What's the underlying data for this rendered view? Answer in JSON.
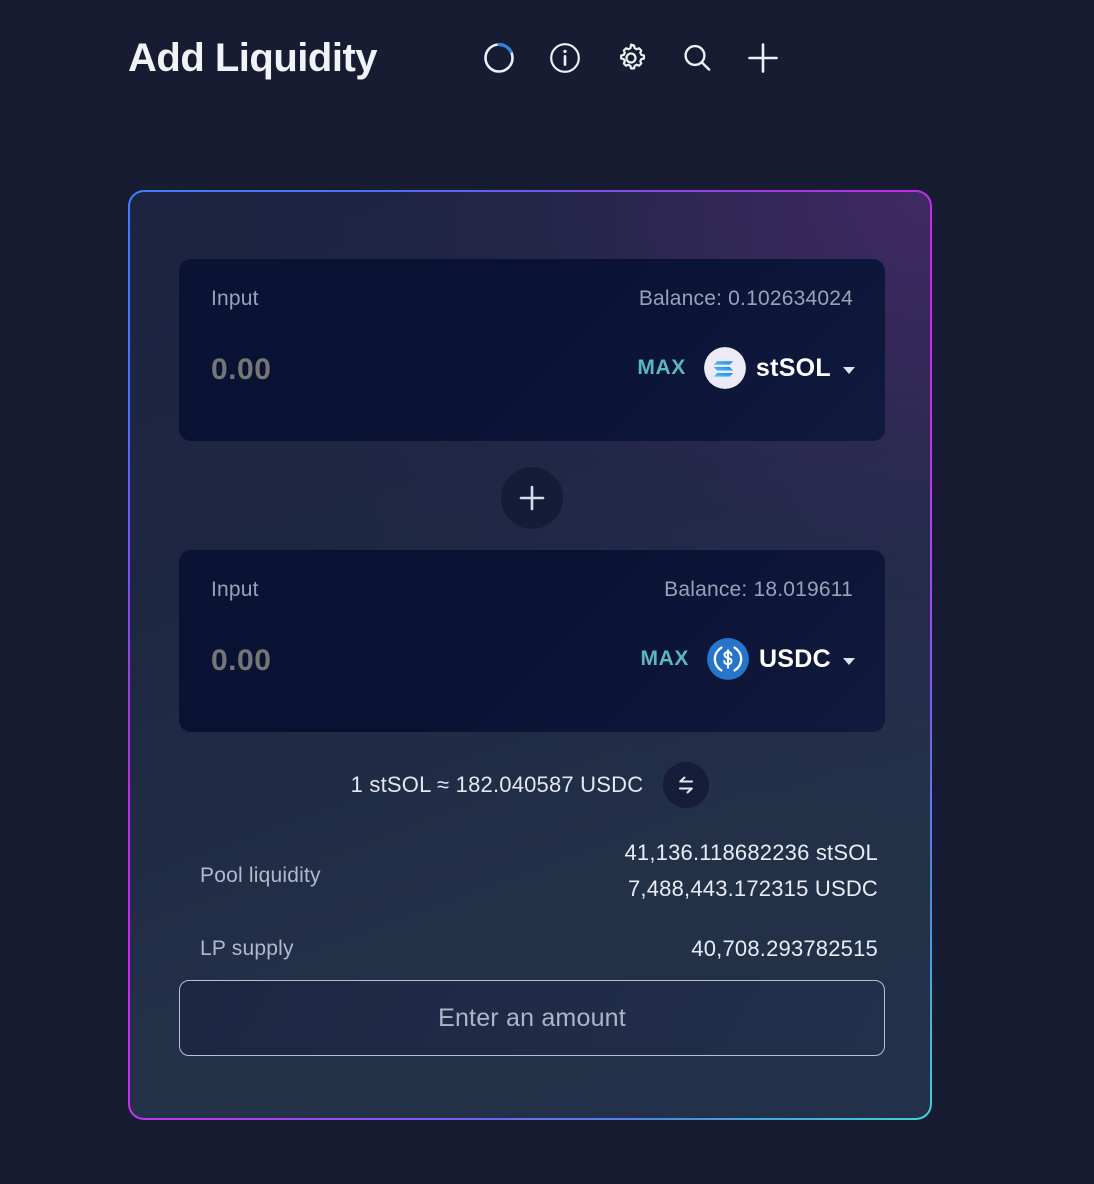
{
  "header": {
    "title": "Add Liquidity",
    "icons": [
      {
        "name": "loading-spinner-icon",
        "label": "loading"
      },
      {
        "name": "info-icon",
        "label": "info"
      },
      {
        "name": "gear-icon",
        "label": "settings"
      },
      {
        "name": "search-icon",
        "label": "search"
      },
      {
        "name": "plus-icon",
        "label": "add"
      }
    ]
  },
  "inputs": [
    {
      "label": "Input",
      "balance": "Balance: 0.102634024",
      "amount": "0.00",
      "placeholder": "0.00",
      "max_label": "MAX",
      "token": "stSOL",
      "token_logo": "solana-logo-icon"
    },
    {
      "label": "Input",
      "balance": "Balance: 18.019611",
      "amount": "0.00",
      "placeholder": "0.00",
      "max_label": "MAX",
      "token": "USDC",
      "token_logo": "usdc-logo-icon"
    }
  ],
  "add_button": {
    "name": "add-input-button",
    "glyph": "+"
  },
  "rate": {
    "text": "1 stSOL ≈ 182.040587 USDC",
    "swap_icon": "swap-arrows-icon"
  },
  "stats": {
    "pool_liquidity": {
      "label": "Pool liquidity",
      "values": [
        "41,136.118682236 stSOL",
        "7,488,443.172315 USDC"
      ]
    },
    "lp_supply": {
      "label": "LP supply",
      "value": "40,708.293782515"
    }
  },
  "action": {
    "label": "Enter an amount",
    "disabled": true
  },
  "colors": {
    "page_background": "#181c33",
    "input_card_background": "#0a1234",
    "max_accent": "#5cb6c2",
    "border_gradient_start": "#3b82f6",
    "border_gradient_mid": "#d026e8",
    "border_gradient_end": "#3fd4d4",
    "usdc_blue": "#2775ca",
    "text_primary": "#e9ecf4",
    "text_muted": "#9aa2b8"
  }
}
